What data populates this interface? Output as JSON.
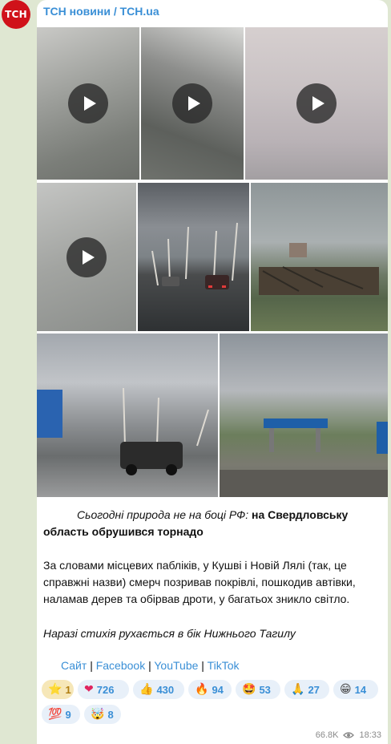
{
  "channel": {
    "name": "ТСН новини / TCH.ua",
    "avatar_text": "ТСН",
    "avatar_color": "#d0121a"
  },
  "media": [
    {
      "kind": "video",
      "desc": "blurred sky"
    },
    {
      "kind": "video",
      "desc": "blurred sky"
    },
    {
      "kind": "video",
      "desc": "blurred sky"
    },
    {
      "kind": "video",
      "desc": "blurred sky"
    },
    {
      "kind": "photo",
      "desc": "road with broken trees"
    },
    {
      "kind": "photo",
      "desc": "destroyed buildings"
    },
    {
      "kind": "photo",
      "desc": "road with car"
    },
    {
      "kind": "photo",
      "desc": "damaged gas station"
    }
  ],
  "post": {
    "line1_italic": "Сьогодні природа не на боці РФ:",
    "line1_bold": " на Свердловську",
    "line2_bold": "область обрушився торнадо",
    "para2": [
      "За словами місцевих пабліків, у Кушві і Новій Лялі (так, це",
      "справжні назви) смерч позривав покрівлі, пошкодив автівки,",
      "наламав дерев та обірвав дроти, у багатьох зникло світло."
    ],
    "para3_italic": "Наразі стихія рухається в бік Нижнього Тагилу"
  },
  "links": {
    "site": "Сайт",
    "sep": "|",
    "facebook": "Facebook",
    "youtube": "YouTube",
    "tiktok": "TikTok"
  },
  "reactions": [
    {
      "emoji": "⭐",
      "count": "1",
      "selected": false,
      "star": true
    },
    {
      "emoji": "❤",
      "count": "726",
      "selected": false
    },
    {
      "emoji": "👍",
      "count": "430",
      "selected": false
    },
    {
      "emoji": "🔥",
      "count": "94",
      "selected": false
    },
    {
      "emoji": "🤩",
      "count": "53",
      "selected": false
    },
    {
      "emoji": "🙏",
      "count": "27",
      "selected": false
    },
    {
      "emoji": "😁",
      "count": "14",
      "selected": false
    },
    {
      "emoji": "💯",
      "count": "9",
      "selected": false
    },
    {
      "emoji": "🤯",
      "count": "8",
      "selected": false
    }
  ],
  "footer": {
    "views": "66.8K",
    "time": "18:33"
  }
}
